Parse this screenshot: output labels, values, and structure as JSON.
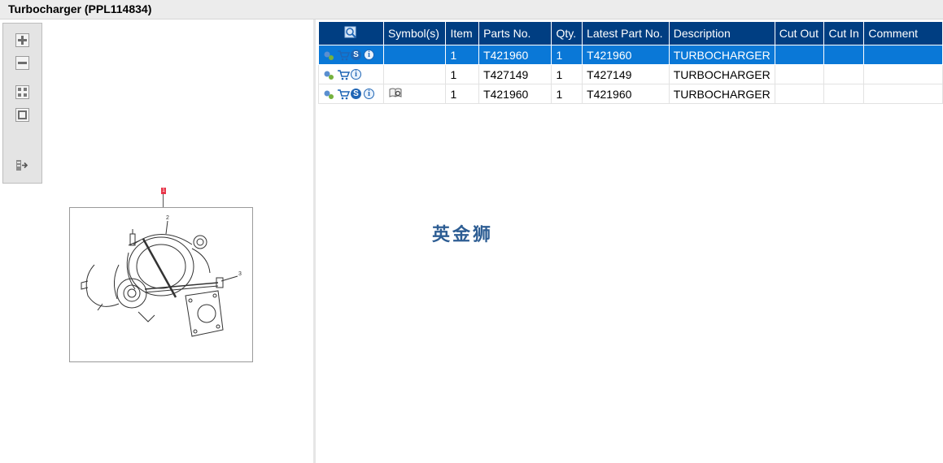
{
  "title": "Turbocharger (PPL114834)",
  "toolbar": {
    "buttons": [
      "zoom-in",
      "zoom-out",
      "fit-all",
      "fit-window",
      "export"
    ]
  },
  "drawing": {
    "callouts": [
      "1",
      "2",
      "3"
    ]
  },
  "table": {
    "headers": {
      "icons": "",
      "symbols": "Symbol(s)",
      "item": "Item",
      "parts_no": "Parts No.",
      "qty": "Qty.",
      "latest_part_no": "Latest Part No.",
      "description": "Description",
      "cut_out": "Cut Out",
      "cut_in": "Cut In",
      "comment": "Comment"
    },
    "rows": [
      {
        "selected": true,
        "icons": [
          "gears-icon",
          "cart-icon",
          "s-icon",
          "info-icon"
        ],
        "symbol": "",
        "item": "1",
        "parts_no": "T421960",
        "qty": "1",
        "latest_part_no": "T421960",
        "description": "TURBOCHARGER",
        "cut_out": "",
        "cut_in": "",
        "comment": ""
      },
      {
        "selected": false,
        "icons": [
          "gears-icon",
          "cart-icon",
          "info-icon"
        ],
        "symbol": "",
        "item": "1",
        "parts_no": "T427149",
        "qty": "1",
        "latest_part_no": "T427149",
        "description": "TURBOCHARGER",
        "cut_out": "",
        "cut_in": "",
        "comment": ""
      },
      {
        "selected": false,
        "icons": [
          "gears-icon",
          "cart-icon",
          "s-icon",
          "info-icon"
        ],
        "symbol": "book-icon",
        "item": "1",
        "parts_no": "T421960",
        "qty": "1",
        "latest_part_no": "T421960",
        "description": "TURBOCHARGER",
        "cut_out": "",
        "cut_in": "",
        "comment": ""
      }
    ]
  },
  "watermark": "英金狮",
  "colors": {
    "header_bg": "#003e82",
    "selected_row": "#0a78d7",
    "watermark": "#2d5d93",
    "callout": "#e8364a"
  }
}
